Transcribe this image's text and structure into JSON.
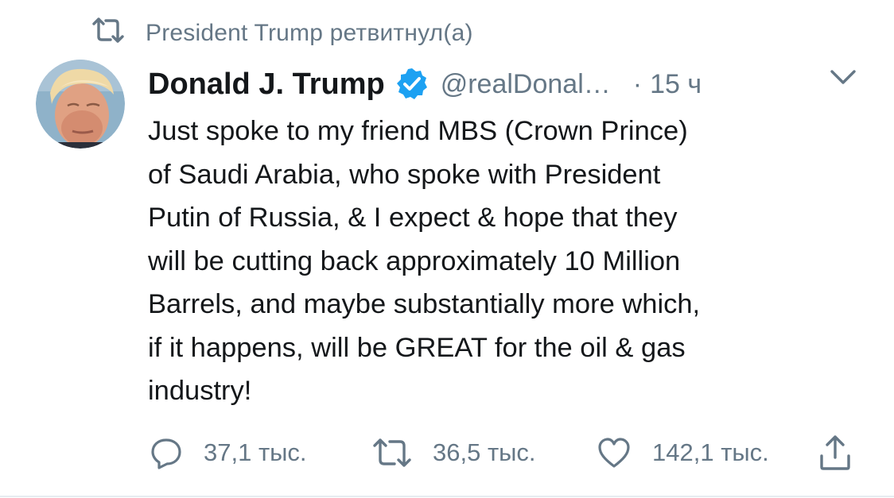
{
  "retweet_context": {
    "icon": "retweet-icon",
    "text": "President Trump ретвитнул(а)"
  },
  "author": {
    "avatar": "avatar-portrait",
    "name": "Donald J. Trump",
    "verified_icon": "verified-badge-icon",
    "handle": "@realDonal…",
    "separator": "·",
    "time": "15 ч"
  },
  "menu_icon": "chevron-down-icon",
  "tweet": {
    "text": "Just spoke to my friend MBS (Crown Prince)\nof Saudi Arabia, who spoke with President\nPutin of Russia, & I expect & hope that they\nwill be cutting back approximately 10 Million\nBarrels, and maybe substantially more which,\nif it happens, will be GREAT for the oil & gas\nindustry!"
  },
  "actions": {
    "reply": {
      "icon": "reply-icon",
      "count": "37,1 тыс."
    },
    "retweet": {
      "icon": "retweet-icon",
      "count": "36,5 тыс."
    },
    "like": {
      "icon": "heart-icon",
      "count": "142,1 тыс."
    },
    "share": {
      "icon": "share-icon"
    }
  },
  "colors": {
    "text_primary": "#14171a",
    "text_secondary": "#657786",
    "verified_blue": "#1da1f2",
    "divider": "#e6ecf0"
  }
}
